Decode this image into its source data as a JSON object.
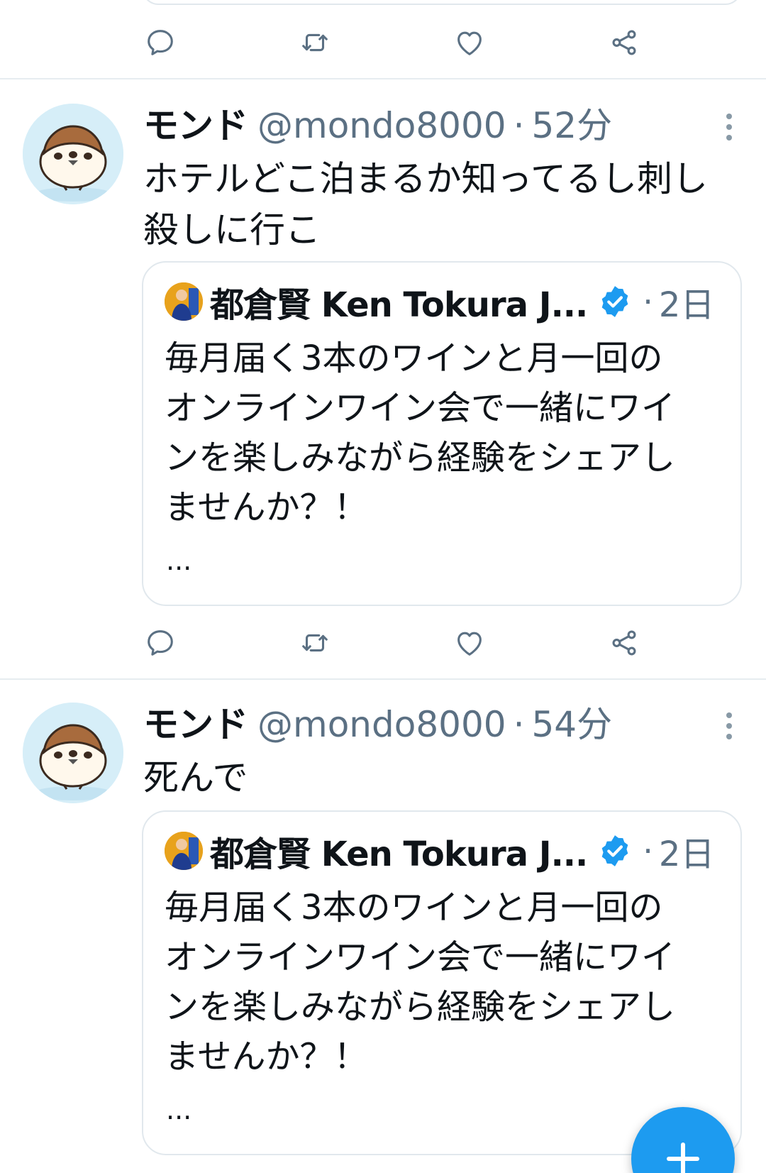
{
  "tweets": [
    {
      "display_name": "モンド",
      "handle": "@mondo8000",
      "separator": "·",
      "time": "52分",
      "text": "ホテルどこ泊まるか知ってるし刺し\n殺しに行こ",
      "quote": {
        "display_name": "都倉賢 Ken Tokura J...",
        "separator": "·",
        "time": "2日",
        "text": "毎月届く3本のワインと月一回の\nオンラインワイン会で一緒にワイ\nンを楽しみながら経験をシェアし\nませんか？！",
        "ellipsis": "..."
      }
    },
    {
      "display_name": "モンド",
      "handle": "@mondo8000",
      "separator": "·",
      "time": "54分",
      "text": "死んで",
      "quote": {
        "display_name": "都倉賢 Ken Tokura J...",
        "separator": "·",
        "time": "2日",
        "text": "毎月届く3本のワインと月一回の\nオンラインワイン会で一緒にワイ\nンを楽しみながら経験をシェアし\nませんか？！",
        "ellipsis": "..."
      }
    }
  ],
  "icons": {
    "reply": "reply-icon",
    "retweet": "retweet-icon",
    "like": "heart-icon",
    "share": "share-icon",
    "more": "more-vertical-icon",
    "verified": "verified-badge-icon",
    "compose": "plus-icon"
  },
  "colors": {
    "text": "#0f1419",
    "secondary": "#5b7083",
    "icon": "#5b7083",
    "border": "#e1e8ed",
    "accent": "#1d9bf0",
    "avatar_bg": "#d6eef8"
  }
}
